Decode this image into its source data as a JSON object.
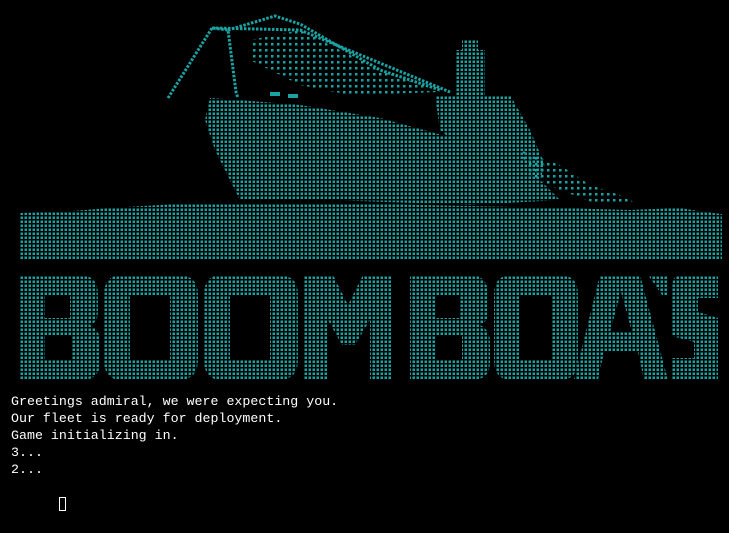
{
  "terminal": {
    "banner_title": "BOOM BOATS",
    "art_color": "#1aa3a3",
    "text_color": "#ffffff",
    "background": "#000000",
    "lines": [
      "Greetings admiral, we were expecting you.",
      "Our fleet is ready for deployment.",
      "Game initializing in.",
      "3...",
      "2..."
    ]
  }
}
